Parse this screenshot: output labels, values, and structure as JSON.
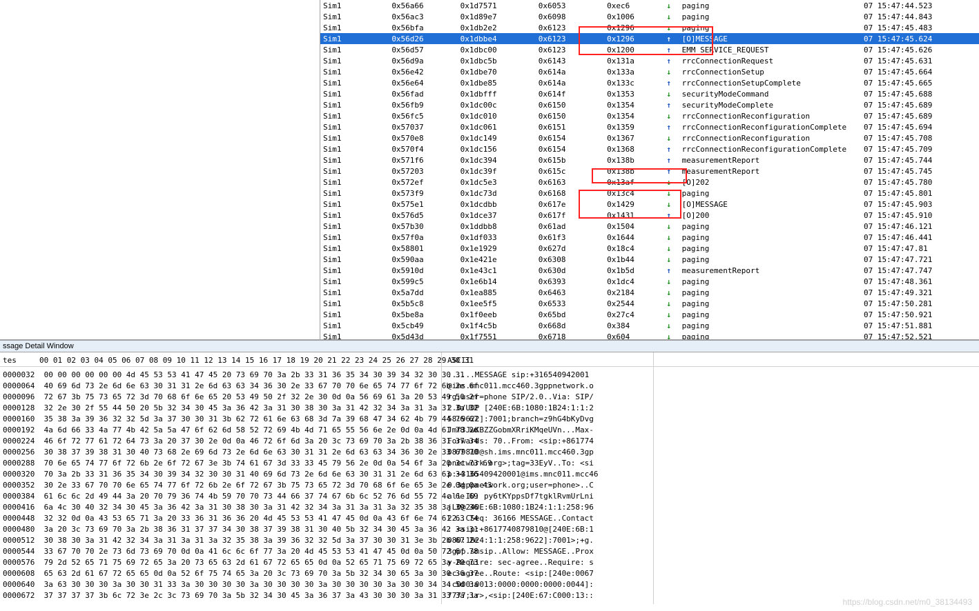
{
  "watermark": "https://blog.csdn.net/m0_38134493",
  "detail_title": "ssage Detail Window",
  "hex_header": "tes     00 01 02 03 04 05 06 07 08 09 10 11 12 13 14 15 16 17 18 19 20 21 22 23 24 25 26 27 28 29 30 31",
  "ascii_header": "ASCII",
  "rows": [
    {
      "sim": "Sim1",
      "c1": "0x56a66",
      "c2": "0x1d7571",
      "c3": "0x6053",
      "c4": "0xec6",
      "dir": "dn",
      "msg": "paging",
      "ts": "07 15:47:44.523"
    },
    {
      "sim": "Sim1",
      "c1": "0x56ac3",
      "c2": "0x1d89e7",
      "c3": "0x6098",
      "c4": "0x1006",
      "dir": "dn",
      "msg": "paging",
      "ts": "07 15:47:44.843"
    },
    {
      "sim": "Sim1",
      "c1": "0x56bfa",
      "c2": "0x1db2e2",
      "c3": "0x6123",
      "c4": "0x1296",
      "dir": "dn",
      "msg": "paging",
      "ts": "07 15:47:45.483"
    },
    {
      "sim": "Sim1",
      "c1": "0x56d26",
      "c2": "0x1dbbe4",
      "c3": "0x6123",
      "c4": "0x1296",
      "dir": "up",
      "msg": "[O]MESSAGE",
      "ts": "07 15:47:45.624",
      "sel": true
    },
    {
      "sim": "Sim1",
      "c1": "0x56d57",
      "c2": "0x1dbc00",
      "c3": "0x6123",
      "c4": "0x1200",
      "dir": "up",
      "msg": "EMM_SERVICE_REQUEST",
      "ts": "07 15:47:45.626"
    },
    {
      "sim": "Sim1",
      "c1": "0x56d9a",
      "c2": "0x1dbc5b",
      "c3": "0x6143",
      "c4": "0x131a",
      "dir": "up",
      "msg": "rrcConnectionRequest",
      "ts": "07 15:47:45.631"
    },
    {
      "sim": "Sim1",
      "c1": "0x56e42",
      "c2": "0x1dbe70",
      "c3": "0x614a",
      "c4": "0x133a",
      "dir": "dn",
      "msg": "rrcConnectionSetup",
      "ts": "07 15:47:45.664"
    },
    {
      "sim": "Sim1",
      "c1": "0x56e64",
      "c2": "0x1dbe85",
      "c3": "0x614a",
      "c4": "0x133c",
      "dir": "up",
      "msg": "rrcConnectionSetupComplete",
      "ts": "07 15:47:45.665"
    },
    {
      "sim": "Sim1",
      "c1": "0x56fad",
      "c2": "0x1dbfff",
      "c3": "0x614f",
      "c4": "0x1353",
      "dir": "dn",
      "msg": "securityModeCommand",
      "ts": "07 15:47:45.688"
    },
    {
      "sim": "Sim1",
      "c1": "0x56fb9",
      "c2": "0x1dc00c",
      "c3": "0x6150",
      "c4": "0x1354",
      "dir": "up",
      "msg": "securityModeComplete",
      "ts": "07 15:47:45.689"
    },
    {
      "sim": "Sim1",
      "c1": "0x56fc5",
      "c2": "0x1dc010",
      "c3": "0x6150",
      "c4": "0x1354",
      "dir": "dn",
      "msg": "rrcConnectionReconfiguration",
      "ts": "07 15:47:45.689"
    },
    {
      "sim": "Sim1",
      "c1": "0x57037",
      "c2": "0x1dc061",
      "c3": "0x6151",
      "c4": "0x1359",
      "dir": "up",
      "msg": "rrcConnectionReconfigurationComplete",
      "ts": "07 15:47:45.694"
    },
    {
      "sim": "Sim1",
      "c1": "0x570e8",
      "c2": "0x1dc149",
      "c3": "0x6154",
      "c4": "0x1367",
      "dir": "dn",
      "msg": "rrcConnectionReconfiguration",
      "ts": "07 15:47:45.708"
    },
    {
      "sim": "Sim1",
      "c1": "0x570f4",
      "c2": "0x1dc156",
      "c3": "0x6154",
      "c4": "0x1368",
      "dir": "up",
      "msg": "rrcConnectionReconfigurationComplete",
      "ts": "07 15:47:45.709"
    },
    {
      "sim": "Sim1",
      "c1": "0x571f6",
      "c2": "0x1dc394",
      "c3": "0x615b",
      "c4": "0x138b",
      "dir": "up",
      "msg": "measurementReport",
      "ts": "07 15:47:45.744"
    },
    {
      "sim": "Sim1",
      "c1": "0x57203",
      "c2": "0x1dc39f",
      "c3": "0x615c",
      "c4": "0x138b",
      "dir": "up",
      "msg": "measurementReport",
      "ts": "07 15:47:45.745"
    },
    {
      "sim": "Sim1",
      "c1": "0x572ef",
      "c2": "0x1dc5e3",
      "c3": "0x6163",
      "c4": "0x13af",
      "dir": "dn",
      "msg": "[O]202",
      "ts": "07 15:47:45.780"
    },
    {
      "sim": "Sim1",
      "c1": "0x573f9",
      "c2": "0x1dc73d",
      "c3": "0x6168",
      "c4": "0x13c4",
      "dir": "dn",
      "msg": "paging",
      "ts": "07 15:47:45.801"
    },
    {
      "sim": "Sim1",
      "c1": "0x575e1",
      "c2": "0x1dcdbb",
      "c3": "0x617e",
      "c4": "0x1429",
      "dir": "dn",
      "msg": "[O]MESSAGE",
      "ts": "07 15:47:45.903"
    },
    {
      "sim": "Sim1",
      "c1": "0x576d5",
      "c2": "0x1dce37",
      "c3": "0x617f",
      "c4": "0x1431",
      "dir": "up",
      "msg": "[O]200",
      "ts": "07 15:47:45.910"
    },
    {
      "sim": "Sim1",
      "c1": "0x57b30",
      "c2": "0x1ddbb8",
      "c3": "0x61ad",
      "c4": "0x1504",
      "dir": "dn",
      "msg": "paging",
      "ts": "07 15:47:46.121"
    },
    {
      "sim": "Sim1",
      "c1": "0x57f0a",
      "c2": "0x1df033",
      "c3": "0x61f3",
      "c4": "0x1644",
      "dir": "dn",
      "msg": "paging",
      "ts": "07 15:47:46.441"
    },
    {
      "sim": "Sim1",
      "c1": "0x58801",
      "c2": "0x1e1929",
      "c3": "0x627d",
      "c4": "0x18c4",
      "dir": "dn",
      "msg": "paging",
      "ts": "07 15:47:47.81"
    },
    {
      "sim": "Sim1",
      "c1": "0x590aa",
      "c2": "0x1e421e",
      "c3": "0x6308",
      "c4": "0x1b44",
      "dir": "dn",
      "msg": "paging",
      "ts": "07 15:47:47.721"
    },
    {
      "sim": "Sim1",
      "c1": "0x5910d",
      "c2": "0x1e43c1",
      "c3": "0x630d",
      "c4": "0x1b5d",
      "dir": "up",
      "msg": "measurementReport",
      "ts": "07 15:47:47.747"
    },
    {
      "sim": "Sim1",
      "c1": "0x599c5",
      "c2": "0x1e6b14",
      "c3": "0x6393",
      "c4": "0x1dc4",
      "dir": "dn",
      "msg": "paging",
      "ts": "07 15:47:48.361"
    },
    {
      "sim": "Sim1",
      "c1": "0x5a7dd",
      "c2": "0x1ea885",
      "c3": "0x6463",
      "c4": "0x2184",
      "dir": "dn",
      "msg": "paging",
      "ts": "07 15:47:49.321"
    },
    {
      "sim": "Sim1",
      "c1": "0x5b5c8",
      "c2": "0x1ee5f5",
      "c3": "0x6533",
      "c4": "0x2544",
      "dir": "dn",
      "msg": "paging",
      "ts": "07 15:47:50.281"
    },
    {
      "sim": "Sim1",
      "c1": "0x5be8a",
      "c2": "0x1f0eeb",
      "c3": "0x65bd",
      "c4": "0x27c4",
      "dir": "dn",
      "msg": "paging",
      "ts": "07 15:47:50.921"
    },
    {
      "sim": "Sim1",
      "c1": "0x5cb49",
      "c2": "0x1f4c5b",
      "c3": "0x668d",
      "c4": "0x384",
      "dir": "dn",
      "msg": "paging",
      "ts": "07 15:47:51.881"
    },
    {
      "sim": "Sim1",
      "c1": "0x5d43d",
      "c2": "0x1f7551",
      "c3": "0x6718",
      "c4": "0x604",
      "dir": "dn",
      "msg": "paging",
      "ts": "07 15:47:52.521"
    }
  ],
  "hex": [
    {
      "off": "0000032",
      "b": "00 00 00 00 00 00 4d 45 53 53 41 47 45 20 73 69 70 3a 2b 33 31 36 35 34 30 39 34 32 30 30 31"
    },
    {
      "off": "0000064",
      "b": "40 69 6d 73 2e 6d 6e 63 30 31 31 2e 6d 63 63 34 36 30 2e 33 67 70 70 6e 65 74 77 6f 72 6b 2e 6f"
    },
    {
      "off": "0000096",
      "b": "72 67 3b 75 73 65 72 3d 70 68 6f 6e 65 20 53 49 50 2f 32 2e 30 0d 0a 56 69 61 3a 20 53 49 50 2f"
    },
    {
      "off": "0000128",
      "b": "32 2e 30 2f 55 44 50 20 5b 32 34 30 45 3a 36 42 3a 31 30 38 30 3a 31 42 32 34 3a 31 3a 31 3a 32"
    },
    {
      "off": "0000160",
      "b": "35 38 3a 39 36 32 32 5d 3a 37 30 30 31 3b 62 72 61 6e 63 68 3d 7a 39 68 47 34 62 4b 79 44 76 67"
    },
    {
      "off": "0000192",
      "b": "4a 6d 66 33 4a 77 4b 42 5a 5a 47 6f 62 6d 58 52 72 69 4b 4d 71 65 55 56 6e 2e 0d 0a 4d 61 78 2d"
    },
    {
      "off": "0000224",
      "b": "46 6f 72 77 61 72 64 73 3a 20 37 30 2e 0d 0a 46 72 6f 6d 3a 20 3c 73 69 70 3a 2b 38 36 31 37 34"
    },
    {
      "off": "0000256",
      "b": "30 38 37 39 38 31 30 40 73 68 2e 69 6d 73 2e 6d 6e 63 30 31 31 2e 6d 63 63 34 36 30 2e 33 67 70"
    },
    {
      "off": "0000288",
      "b": "70 6e 65 74 77 6f 72 6b 2e 6f 72 67 3e 3b 74 61 67 3d 33 33 45 79 56 2e 0d 0a 54 6f 3a 20 3c 73 69"
    },
    {
      "off": "0000320",
      "b": "70 3a 2b 33 31 36 35 34 30 39 34 32 30 30 31 40 69 6d 73 2e 6d 6e 63 30 31 31 2e 6d 63 63 34 36"
    },
    {
      "off": "0000352",
      "b": "30 2e 33 67 70 70 6e 65 74 77 6f 72 6b 2e 6f 72 67 3b 75 73 65 72 3d 70 68 6f 6e 65 3e 2e 0d 0a 43"
    },
    {
      "off": "0000384",
      "b": "61 6c 6c 2d 49 44 3a 20 70 79 36 74 4b 59 70 70 73 44 66 37 74 67 6b 6c 52 76 6d 55 72 4c 6e 69"
    },
    {
      "off": "0000416",
      "b": "6a 4c 30 40 32 34 30 45 3a 36 42 3a 31 30 38 30 3a 31 42 32 34 3a 31 3a 31 3a 32 35 38 3a 39 36"
    },
    {
      "off": "0000448",
      "b": "32 32 0d 0a 43 53 65 71 3a 20 33 36 31 36 36 20 4d 45 53 53 41 47 45 0d 0a 43 6f 6e 74 61 63 74"
    },
    {
      "off": "0000480",
      "b": "3a 20 3c 73 69 70 3a 2b 38 36 31 37 37 34 30 38 37 39 38 31 30 40 5b 32 34 30 45 3a 36 42 3a 31"
    },
    {
      "off": "0000512",
      "b": "30 38 30 3a 31 42 32 34 3a 31 3a 31 3a 32 35 38 3a 39 36 32 32 5d 3a 37 30 30 31 3e 3b 2b 67 2e"
    },
    {
      "off": "0000544",
      "b": "33 67 70 70 2e 73 6d 73 69 70 0d 0a 41 6c 6c 6f 77 3a 20 4d 45 53 53 41 47 45 0d 0a 50 72 6f 78"
    },
    {
      "off": "0000576",
      "b": "79 2d 52 65 71 75 69 72 65 3a 20 73 65 63 2d 61 67 72 65 65 0d 0a 52 65 71 75 69 72 65 3a 20 73"
    },
    {
      "off": "0000608",
      "b": "65 63 2d 61 67 72 65 65 0d 0a 52 6f 75 74 65 3a 20 3c 73 69 70 3a 5b 32 34 30 65 3a 30 30 36 37"
    },
    {
      "off": "0000640",
      "b": "3a 63 30 30 30 3a 30 30 31 33 3a 30 30 30 30 3a 30 30 30 30 3a 30 30 30 30 3a 30 30 34 34 5d 3a"
    },
    {
      "off": "0000672",
      "b": "37 37 37 37 3b 6c 72 3e 2c 3c 73 69 70 3a 5b 32 34 30 45 3a 36 37 3a 43 30 30 30 3a 31 33 3a 3a"
    }
  ],
  "ascii": [
    "......MESSAGE sip:+316540942001",
    "@ims.mnc011.mcc460.3gppnetwork.o",
    "rg;user=phone SIP/2.0..Via: SIP/",
    "2.0/UDP [240E:6B:1080:1B24:1:1:2",
    "58:9622]:7001;branch=z9hG4bKyDvg",
    "Jmf3JwKBZZGobmXRriKMqeUVn...Max-",
    "Forwards: 70..From: <sip:+861774",
    "0879810@sh.ims.mnc011.mcc460.3gp",
    "pnetwork.org>;tag=33EyV..To: <si",
    "p:+3165409420001@ims.mnc011.mcc46",
    "0.3gppnetwork.org;user=phone>..C",
    "all-ID: py6tKYppsDf7tgklRvmUrLni",
    "jL0@240E:6B:1080:1B24:1:1:258:96",
    "22..CSeq: 36166 MESSAGE..Contact",
    ": <sip:+8617740879810@[240E:6B:1",
    "080:1B24:1:1:258:9622]:7001>;+g.",
    "3gpp.smsip..Allow: MESSAGE..Prox",
    "y-Require: sec-agree..Require: s",
    "ec-agree..Route: <sip:[240e:0067",
    ":c000:0013:0000:0000:0000:0044]:",
    "7777;lr>,<sip:[240E:67:C000:13::"
  ]
}
